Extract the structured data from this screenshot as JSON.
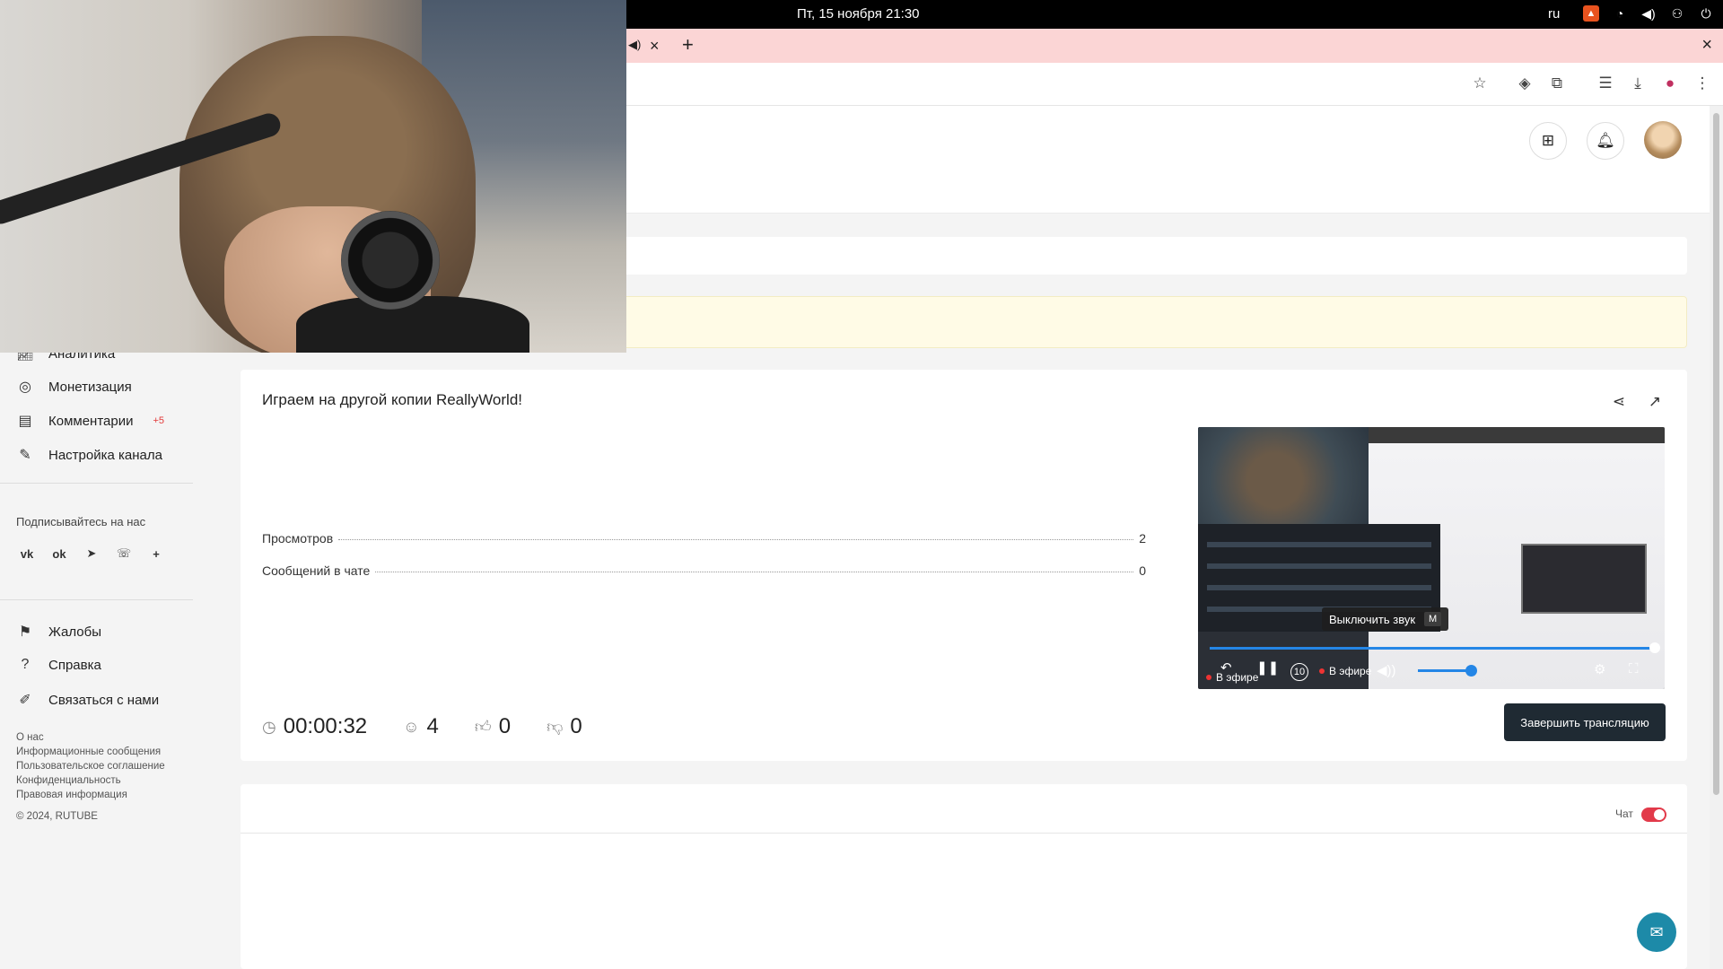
{
  "system": {
    "datetime": "Пт, 15 ноября  21:30",
    "lang": "ru",
    "icons": [
      "app-indicator-icon",
      "wifi-icon",
      "volume-icon",
      "power-profile-icon",
      "power-icon"
    ]
  },
  "browser": {
    "tab_audio_icon": "speaker-icon",
    "tab_close": "×",
    "new_tab": "+",
    "window_close": "×",
    "toolbar_icons": [
      "star-icon",
      "extension-shield-icon",
      "puzzle-icon",
      "media-queue-icon",
      "download-icon",
      "profile-icon",
      "kebab-menu-icon"
    ]
  },
  "header": {
    "upload_icon": "plus-square-icon",
    "bell_icon": "bell-icon"
  },
  "sidebar": {
    "items_top": [
      {
        "label": "Аналитика",
        "icon": "chart-icon"
      },
      {
        "label": "Монетизация",
        "icon": "coin-icon"
      },
      {
        "label": "Комментарии",
        "icon": "comments-icon",
        "badge": "+5"
      },
      {
        "label": "Настройка канала",
        "icon": "wrench-icon"
      }
    ],
    "follow_title": "Подписывайтесь на нас",
    "socials": [
      "vk-icon",
      "ok-icon",
      "telegram-icon",
      "viber-icon",
      "plus-icon"
    ],
    "items_bottom": [
      {
        "label": "Жалобы",
        "icon": "flag-icon"
      },
      {
        "label": "Справка",
        "icon": "question-icon"
      },
      {
        "label": "Связаться с нами",
        "icon": "pencil-icon"
      }
    ],
    "footer_links": [
      "О нас",
      "Информационные сообщения",
      "Пользовательское соглашение",
      "Конфиденциальность",
      "Правовая информация"
    ],
    "copyright": "© 2024, RUTUBE"
  },
  "stream": {
    "title": "Играем на другой копии ReallyWorld!",
    "stats": [
      {
        "label": "Просмотров",
        "value": "2"
      },
      {
        "label": "Сообщений в чате",
        "value": "0"
      }
    ],
    "duration": "00:00:32",
    "viewers": "4",
    "likes": "0",
    "dislikes": "0",
    "end_button": "Завершить трансляцию"
  },
  "player": {
    "live_label_1": "В эфире",
    "live_label_2": "В эфире",
    "tooltip": "Выключить звук",
    "tooltip_key": "M",
    "rewind_label": "10",
    "progress": 1.0,
    "volume": 0.6
  },
  "chat": {
    "label": "Чат",
    "enabled": true
  },
  "colors": {
    "accent_blue": "#2486e6",
    "danger": "#e23a4a",
    "tab_strip": "#fbd5d5",
    "notice_bg": "#fffbe6"
  }
}
